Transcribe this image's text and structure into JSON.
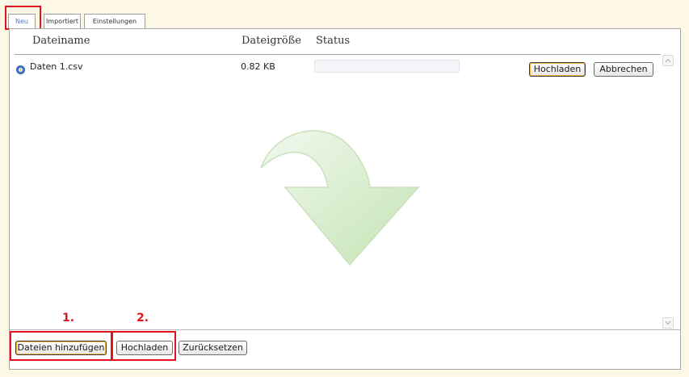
{
  "tabs": [
    {
      "label": "Neu",
      "active": true
    },
    {
      "label": "Importiert",
      "active": false
    },
    {
      "label": "Einstellungen",
      "active": false
    }
  ],
  "table": {
    "columns": [
      "Dateiname",
      "Dateigröße",
      "Status"
    ],
    "rows": [
      {
        "icon": "info-icon",
        "name": "Daten 1.csv",
        "size": "0.82 KB",
        "progress": 0,
        "upload_label": "Hochladen",
        "cancel_label": "Abbrechen"
      }
    ]
  },
  "dropzone": {
    "icon": "drop-arrow-icon"
  },
  "annotations": {
    "step1": "1.",
    "step2": "2."
  },
  "footer": {
    "add_files_label": "Dateien hinzufügen",
    "upload_label": "Hochladen",
    "reset_label": "Zurücksetzen"
  },
  "colors": {
    "highlight": "#e0141c",
    "tab_active_text": "#4f7ab8",
    "background": "#fdf8e6",
    "drop_arrow": "#cfe8c6"
  }
}
